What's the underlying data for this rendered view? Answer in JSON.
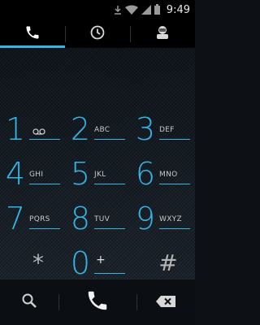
{
  "status_bar": {
    "time": "9:49",
    "icons": [
      "download-icon",
      "wifi-icon",
      "signal-icon",
      "battery-icon"
    ]
  },
  "tabs": [
    {
      "icon": "phone-icon",
      "active": true
    },
    {
      "icon": "clock-icon",
      "active": false
    },
    {
      "icon": "contact-icon",
      "active": false
    }
  ],
  "dialer": {
    "digits": ""
  },
  "keypad": {
    "keys": [
      {
        "digit": "1",
        "letters": ""
      },
      {
        "digit": "2",
        "letters": "ABC"
      },
      {
        "digit": "3",
        "letters": "DEF"
      },
      {
        "digit": "4",
        "letters": "GHI"
      },
      {
        "digit": "5",
        "letters": "JKL"
      },
      {
        "digit": "6",
        "letters": "MNO"
      },
      {
        "digit": "7",
        "letters": "PQRS"
      },
      {
        "digit": "8",
        "letters": "TUV"
      },
      {
        "digit": "9",
        "letters": "WXYZ"
      },
      {
        "symbol": "*"
      },
      {
        "digit": "0",
        "letters": "+"
      },
      {
        "symbol": "#"
      }
    ]
  },
  "bottom_bar": {
    "icons": [
      "search-icon",
      "call-icon",
      "backspace-icon"
    ]
  },
  "colors": {
    "accent": "#33b5e5",
    "background": "#12181f",
    "bar_background": "#000000"
  }
}
